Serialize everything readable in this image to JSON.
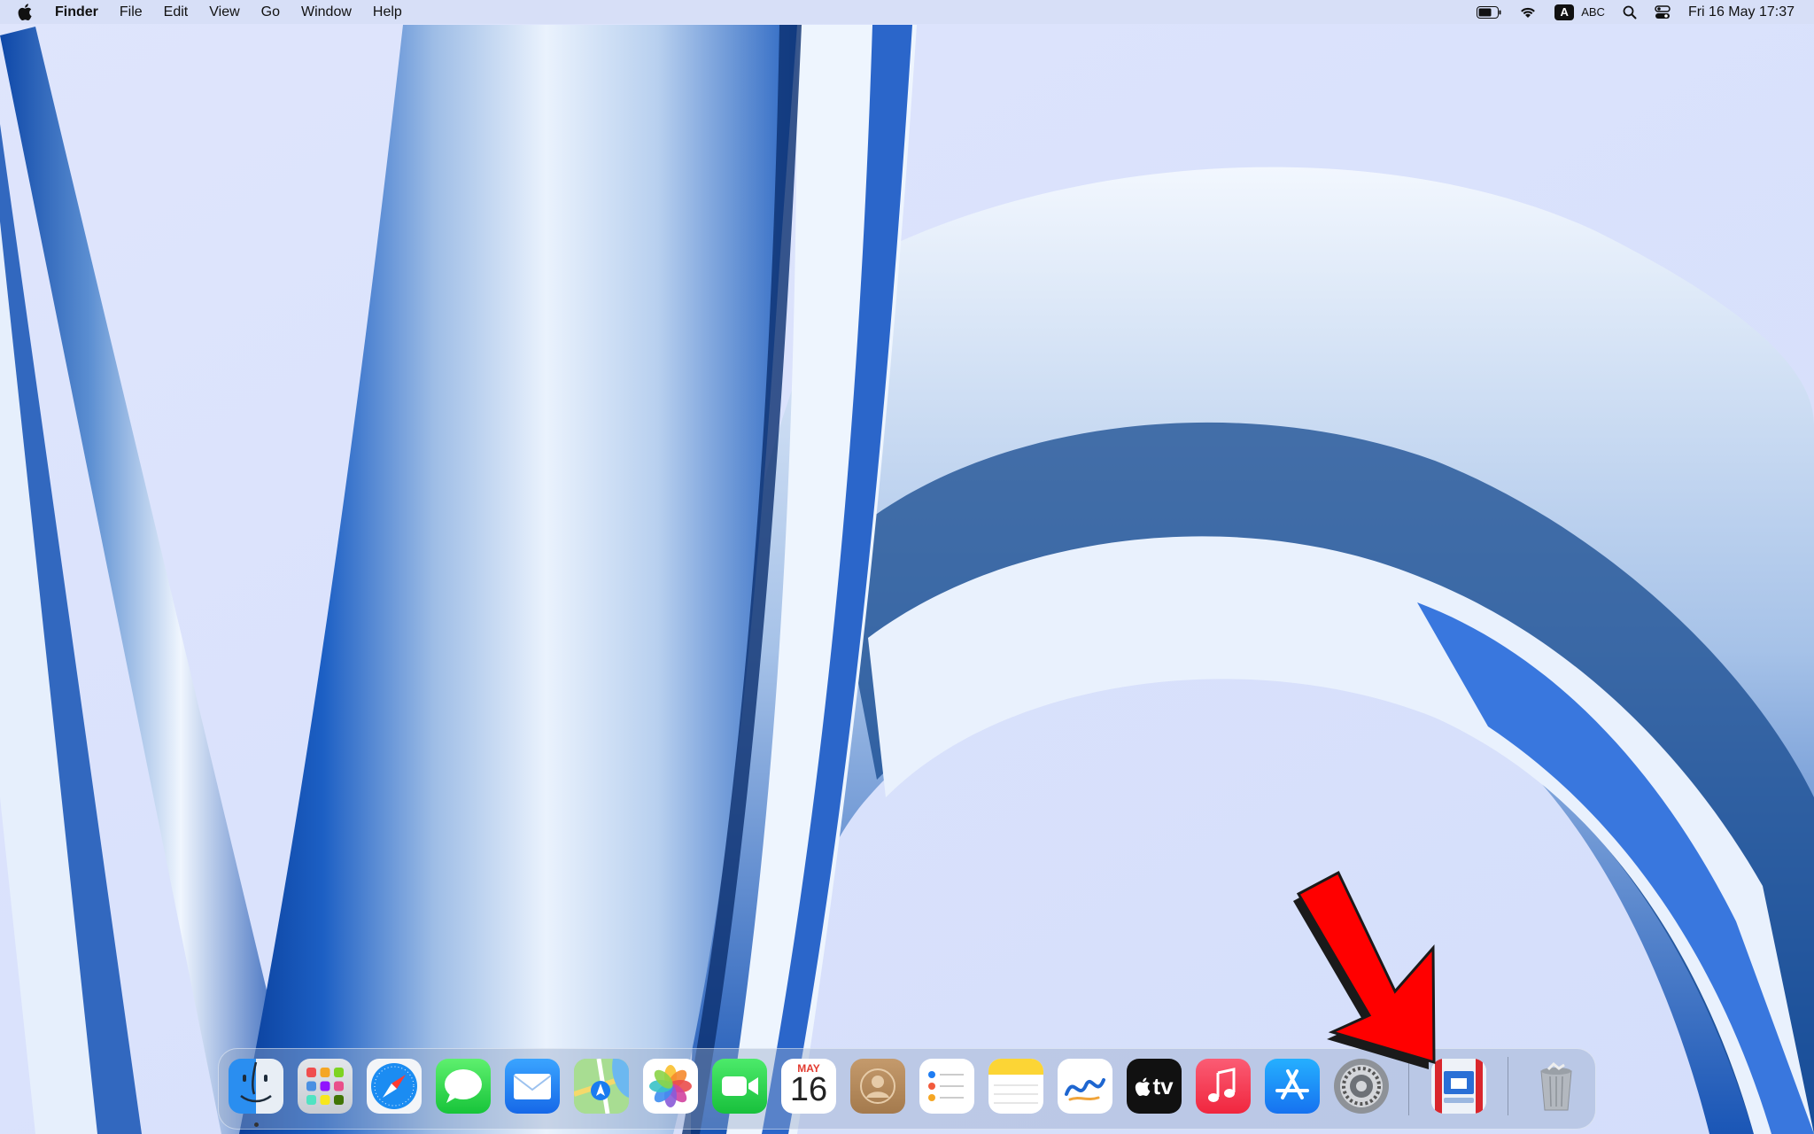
{
  "menubar": {
    "app_name": "Finder",
    "menus": [
      "File",
      "Edit",
      "View",
      "Go",
      "Window",
      "Help"
    ],
    "status": {
      "battery": "battery-icon",
      "wifi": "wifi-icon",
      "input_source_letter": "A",
      "input_source_label": "ABC",
      "spotlight": "search-icon",
      "control_center": "control-center-icon",
      "clock": "Fri 16 May  17:37"
    }
  },
  "dock": {
    "apps": [
      {
        "name": "Finder",
        "icon": "finder-icon",
        "running": true
      },
      {
        "name": "Launchpad",
        "icon": "launchpad-icon"
      },
      {
        "name": "Safari",
        "icon": "safari-icon"
      },
      {
        "name": "Messages",
        "icon": "messages-icon"
      },
      {
        "name": "Mail",
        "icon": "mail-icon"
      },
      {
        "name": "Maps",
        "icon": "maps-icon"
      },
      {
        "name": "Photos",
        "icon": "photos-icon"
      },
      {
        "name": "FaceTime",
        "icon": "facetime-icon"
      },
      {
        "name": "Calendar",
        "icon": "calendar-icon"
      },
      {
        "name": "Contacts",
        "icon": "contacts-icon"
      },
      {
        "name": "Reminders",
        "icon": "reminders-icon"
      },
      {
        "name": "Notes",
        "icon": "notes-icon"
      },
      {
        "name": "Freeform",
        "icon": "freeform-icon"
      },
      {
        "name": "TV",
        "icon": "apple-tv-icon"
      },
      {
        "name": "Music",
        "icon": "music-icon"
      },
      {
        "name": "App Store",
        "icon": "app-store-icon"
      },
      {
        "name": "System Settings",
        "icon": "system-settings-icon"
      },
      {
        "name": "Migration Assistant",
        "icon": "migration-assistant-icon"
      },
      {
        "name": "Trash",
        "icon": "trash-icon"
      }
    ],
    "calendar": {
      "month": "MAY",
      "day": "16"
    },
    "tv_label": "tv"
  },
  "annotation": {
    "arrow_color": "#ff0000",
    "target": "migration-assistant-icon"
  }
}
